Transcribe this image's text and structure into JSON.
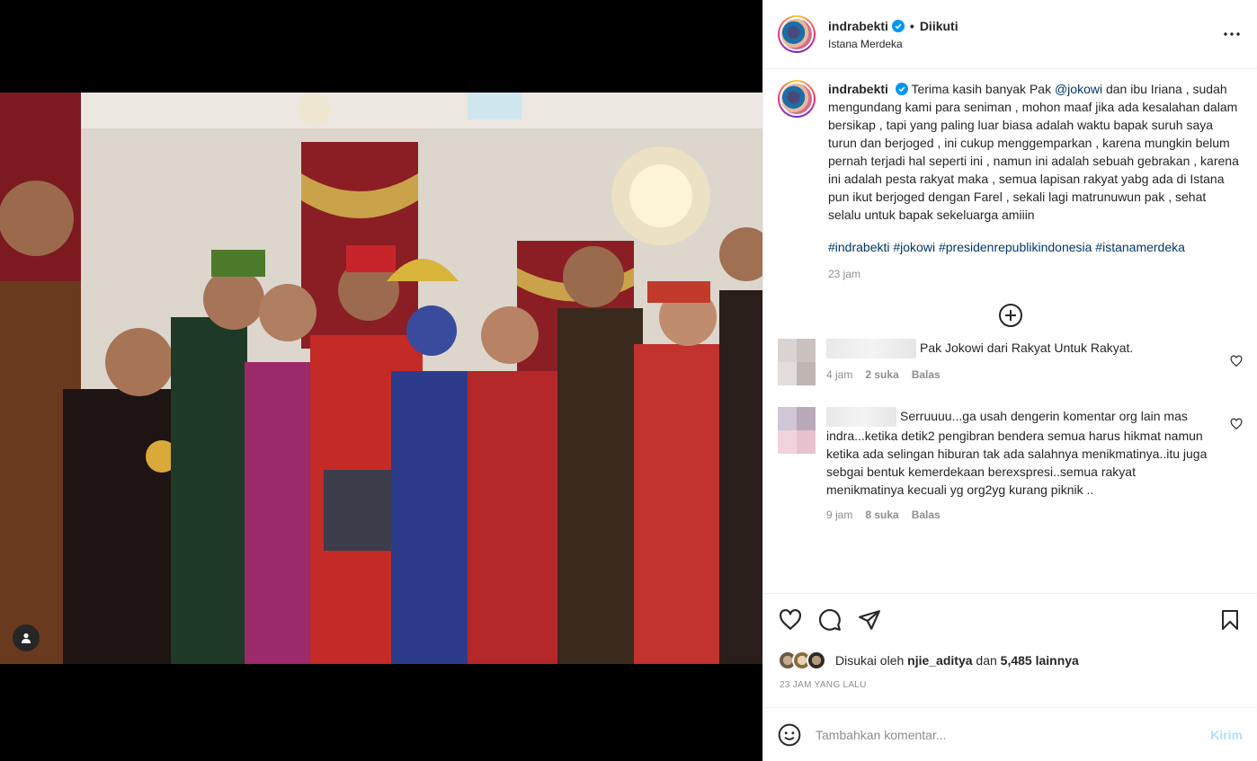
{
  "header": {
    "username": "indrabekti",
    "separator": "•",
    "follow_status": "Diikuti",
    "location": "Istana Merdeka"
  },
  "caption": {
    "username": "indrabekti",
    "text_1": "Terima kasih banyak Pak ",
    "mention": "@jokowi",
    "text_2": " dan ibu Iriana , sudah mengundang kami para seniman , mohon maaf jika ada kesalahan dalam bersikap , tapi yang paling luar biasa adalah waktu bapak suruh saya turun dan berjoged , ini cukup menggemparkan , karena mungkin belum pernah terjadi hal seperti ini , namun ini adalah sebuah gebrakan , karena ini adalah pesta rakyat maka , semua lapisan rakyat yabg ada di Istana pun ikut berjoged dengan Farel , sekali lagi matrunuwun pak , sehat selalu untuk bapak sekeluarga amiiin",
    "hashtags": "#indrabekti #jokowi #presidenrepublikindonesia #istanamerdeka",
    "time": "23 jam"
  },
  "comments": [
    {
      "text": "Pak Jokowi dari Rakyat Untuk Rakyat.",
      "time": "4 jam",
      "likes": "2 suka",
      "reply": "Balas"
    },
    {
      "text": "Serruuuu...ga usah dengerin komentar org lain mas indra...ketika detik2 pengibran bendera semua harus hikmat namun ketika ada selingan hiburan tak ada salahnya menikmatinya..itu juga sebgai bentuk kemerdekaan berexspresi..semua rakyat menikmatinya kecuali yg org2yg kurang piknik ..",
      "time": "9 jam",
      "likes": "8 suka",
      "reply": "Balas"
    }
  ],
  "likes": {
    "prefix": "Disukai oleh ",
    "user": "njie_aditya",
    "middle": " dan ",
    "count": "5,485 lainnya"
  },
  "date": "23 JAM YANG LALU",
  "add_comment": {
    "placeholder": "Tambahkan komentar...",
    "post_label": "Kirim"
  },
  "colors": {
    "verified": "#0095f6",
    "link": "#00376b",
    "muted": "#8e8e8e",
    "post_button": "#b2dffc"
  }
}
